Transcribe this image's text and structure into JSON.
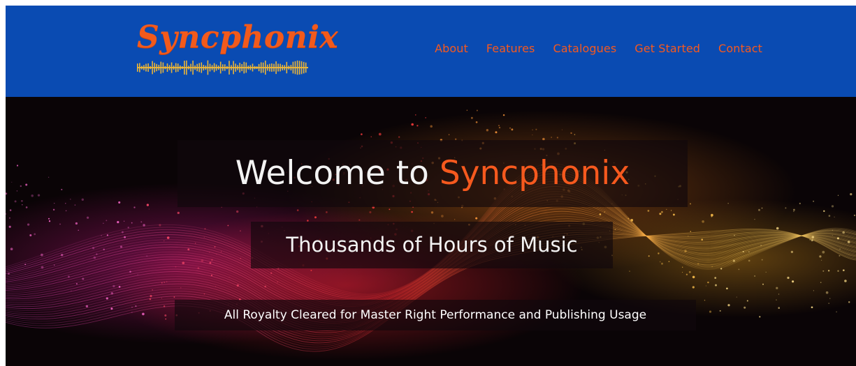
{
  "brand": {
    "name": "Syncphonix"
  },
  "nav": {
    "items": [
      {
        "label": "About"
      },
      {
        "label": "Features"
      },
      {
        "label": "Catalogues"
      },
      {
        "label": "Get Started"
      },
      {
        "label": "Contact"
      }
    ]
  },
  "hero": {
    "title_prefix": "Welcome to ",
    "title_accent": "Syncphonix",
    "subtitle": "Thousands of Hours of Music",
    "tagline": "All Royalty Cleared for Master Right Performance and Publishing Usage"
  },
  "colors": {
    "header_bg": "#0a4bb2",
    "accent": "#f6591e",
    "hero_bg": "#0a0406",
    "wave_gold": "#e8b43a"
  },
  "icons": {
    "logo_wave": "sound-wave-icon"
  }
}
